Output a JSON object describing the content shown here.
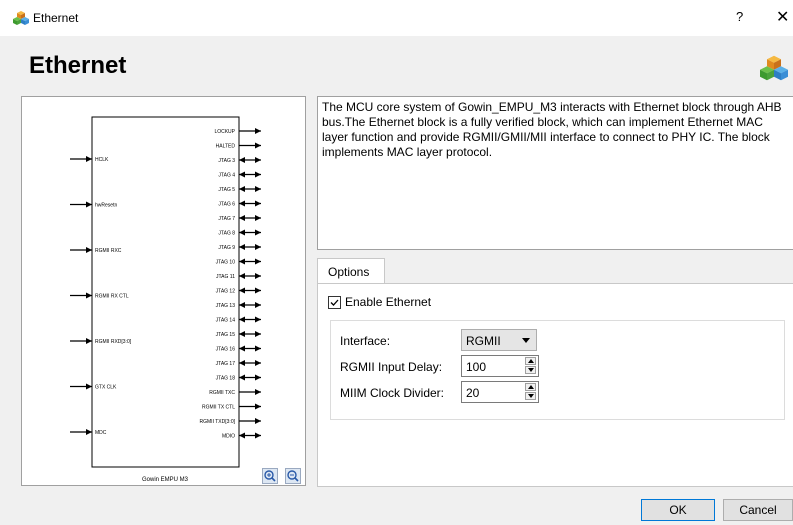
{
  "window": {
    "title": "Ethernet",
    "help_label": "?",
    "close_label": "✕"
  },
  "header": {
    "title": "Ethernet"
  },
  "diagram": {
    "block_name": "Gowin EMPU M3",
    "inputs": [
      "HCLK",
      "hwResetn",
      "RGMII RXC",
      "RGMII RX CTL",
      "RGMII RXD[3:0]",
      "GTX CLK",
      "MDC"
    ],
    "outputs": [
      "LOCKUP",
      "HALTED",
      "JTAG 3",
      "JTAG 4",
      "JTAG 5",
      "JTAG 6",
      "JTAG 7",
      "JTAG 8",
      "JTAG 9",
      "JTAG 10",
      "JTAG 11",
      "JTAG 12",
      "JTAG 13",
      "JTAG 14",
      "JTAG 15",
      "JTAG 16",
      "JTAG 17",
      "JTAG 18",
      "RGMII TXC",
      "RGMII TX CTL",
      "RGMII TXD[3:0]",
      "MDIO"
    ],
    "bidirectional": [
      "JTAG 3",
      "JTAG 4",
      "JTAG 5",
      "JTAG 6",
      "JTAG 7",
      "JTAG 8",
      "JTAG 9",
      "JTAG 10",
      "JTAG 11",
      "JTAG 12",
      "JTAG 13",
      "JTAG 14",
      "JTAG 15",
      "JTAG 16",
      "JTAG 17",
      "JTAG 18",
      "MDIO"
    ]
  },
  "description": "The MCU core system of Gowin_EMPU_M3 interacts with Ethernet block through AHB bus.The Ethernet block is a fully verified block, which can implement Ethernet MAC layer function and provide RGMII/GMII/MII interface to connect to PHY IC. The block implements MAC layer protocol.",
  "tabs": [
    {
      "label": "Options"
    }
  ],
  "options": {
    "enable_label": "Enable Ethernet",
    "enable_checked": true,
    "interface_label": "Interface:",
    "interface_value": "RGMII",
    "input_delay_label": "RGMII Input Delay:",
    "input_delay_value": "100",
    "clock_divider_label": "MIIM Clock Divider:",
    "clock_divider_value": "20"
  },
  "buttons": {
    "ok": "OK",
    "cancel": "Cancel"
  }
}
